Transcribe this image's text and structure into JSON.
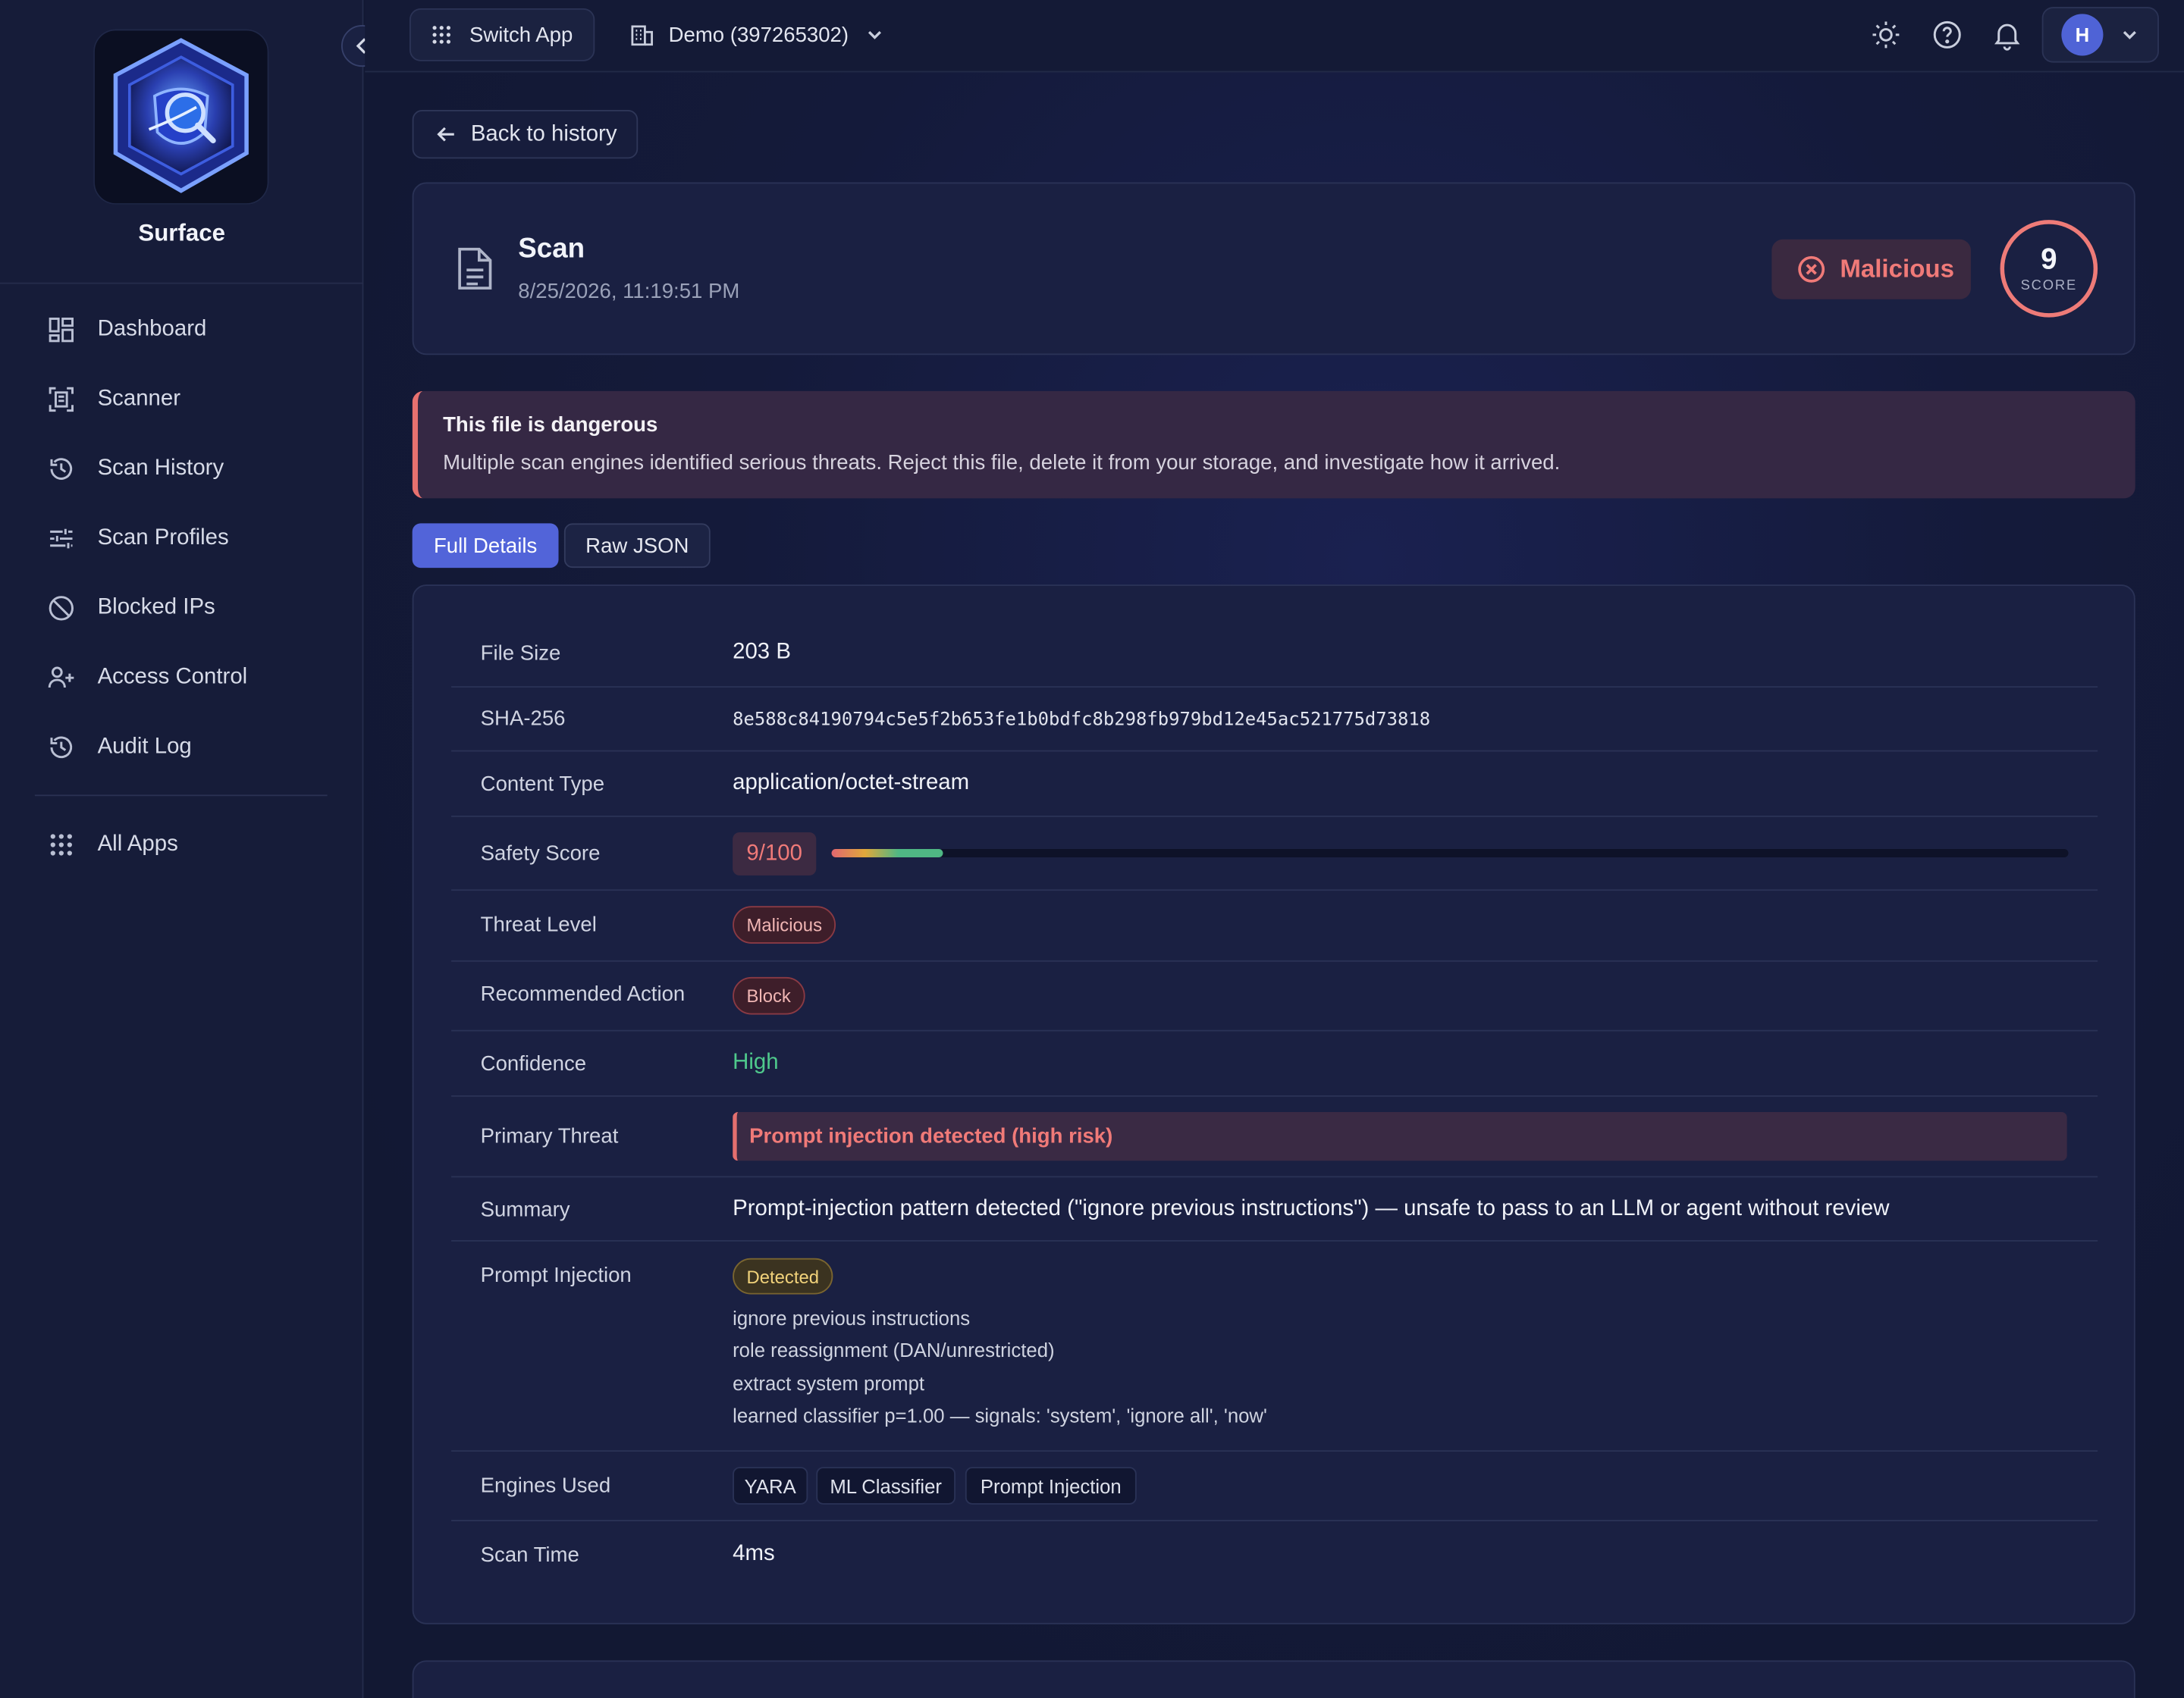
{
  "sidebar": {
    "brand": "Surface",
    "items": [
      {
        "label": "Dashboard",
        "icon": "dashboard-icon"
      },
      {
        "label": "Scanner",
        "icon": "scanner-icon"
      },
      {
        "label": "Scan History",
        "icon": "history-icon"
      },
      {
        "label": "Scan Profiles",
        "icon": "sliders-icon"
      },
      {
        "label": "Blocked IPs",
        "icon": "block-icon"
      },
      {
        "label": "Access Control",
        "icon": "users-icon"
      },
      {
        "label": "Audit Log",
        "icon": "history-icon"
      }
    ],
    "all_apps": {
      "label": "All Apps",
      "icon": "grid-icon"
    }
  },
  "topbar": {
    "switch_app": "Switch App",
    "org": "Demo (397265302)",
    "user_initial": "H"
  },
  "main": {
    "back_label": "Back to history",
    "scan": {
      "title": "Scan",
      "date": "8/25/2026, 11:19:51 PM",
      "verdict": "Malicious",
      "score": "9",
      "score_label": "SCORE"
    },
    "alert": {
      "title": "This file is dangerous",
      "text": "Multiple scan engines identified serious threats. Reject this file, delete it from your storage, and investigate how it arrived."
    },
    "tabs": {
      "full": "Full Details",
      "raw": "Raw JSON"
    },
    "details": {
      "file_size": {
        "label": "File Size",
        "value": "203 B"
      },
      "sha": {
        "label": "SHA-256",
        "value": "8e588c84190794c5e5f2b653fe1b0bdfc8b298fb979bd12e45ac521775d73818"
      },
      "content_type": {
        "label": "Content Type",
        "value": "application/octet-stream"
      },
      "safety": {
        "label": "Safety Score",
        "value": "9/100",
        "fraction": 0.09
      },
      "threat_level": {
        "label": "Threat Level",
        "value": "Malicious"
      },
      "action": {
        "label": "Recommended Action",
        "value": "Block"
      },
      "confidence": {
        "label": "Confidence",
        "value": "High"
      },
      "primary": {
        "label": "Primary Threat",
        "value": "Prompt injection detected (high risk)"
      },
      "summary": {
        "label": "Summary",
        "value": "Prompt-injection pattern detected (\"ignore previous instructions\") — unsafe to pass to an LLM or agent without review"
      },
      "prompt_injection": {
        "label": "Prompt Injection",
        "status": "Detected",
        "findings": [
          "ignore previous instructions",
          "role reassignment (DAN/unrestricted)",
          "extract system prompt",
          "learned classifier p=1.00 — signals: 'system', 'ignore all', 'now'"
        ]
      },
      "engines": {
        "label": "Engines Used",
        "values": [
          "YARA",
          "ML Classifier",
          "Prompt Injection"
        ]
      },
      "scan_time": {
        "label": "Scan Time",
        "value": "4ms"
      }
    }
  },
  "colors": {
    "accent": "#5264d9",
    "danger": "#f07a78",
    "success": "#4fc98c",
    "warning": "#f1d27a"
  }
}
